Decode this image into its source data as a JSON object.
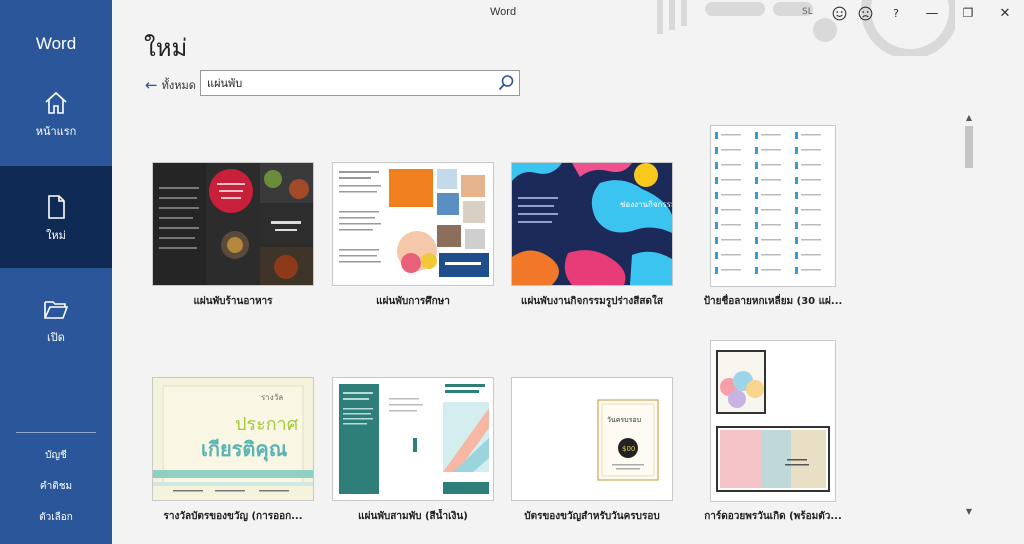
{
  "app": {
    "name": "Word",
    "window_title": "Word",
    "user_initials": "SL"
  },
  "sidebar": {
    "items": [
      {
        "label": "หน้าแรก",
        "icon": "home-icon"
      },
      {
        "label": "ใหม่",
        "icon": "new-document-icon"
      },
      {
        "label": "เปิด",
        "icon": "folder-open-icon"
      }
    ],
    "active_index": 1,
    "bottom_links": [
      {
        "label": "บัญชี"
      },
      {
        "label": "คำติชม"
      },
      {
        "label": "ตัวเลือก"
      }
    ]
  },
  "titlebar": {
    "buttons": [
      "smile-icon",
      "frown-icon",
      "help-icon",
      "minimize-icon",
      "restore-icon",
      "close-icon"
    ],
    "help_label": "?",
    "minimize_label": "—",
    "restore_label": "❐",
    "close_label": "✕"
  },
  "main": {
    "title": "ใหม่",
    "back_label": "ทั้งหมด",
    "search": {
      "value": "แผ่นพับ",
      "placeholder": ""
    }
  },
  "templates": [
    {
      "label": "แผ่นพับร้านอาหาร"
    },
    {
      "label": "แผ่นพับการศึกษา"
    },
    {
      "label": "แผ่นพับงานกิจกรรมรูปร่างสีสดใส"
    },
    {
      "label": "ป้ายชื่อลายหกเหลี่ยม (30 แผ่..."
    },
    {
      "label": "รางวัลบัตรของขวัญ (การออก..."
    },
    {
      "label": "แผ่นพับสามพับ (สีน้ำเงิน)"
    },
    {
      "label": "บัตรของขวัญสำหรับวันครบรอบ"
    },
    {
      "label": "การ์ดอวยพรวันเกิด (พร้อมตัว..."
    }
  ],
  "thumb_text": {
    "certificate_line1": "ประกาศ",
    "certificate_line2": "เกียรติคุณ",
    "certificate_head": "รางวัล",
    "event_title": "ช่องงานกิจกรรม",
    "anniv_title": "วันครบรอบ",
    "anniv_value": "$00"
  },
  "colors": {
    "sidebar": "#2b579a",
    "sidebar_active": "#0f2a55",
    "accent": "#2b579a"
  }
}
